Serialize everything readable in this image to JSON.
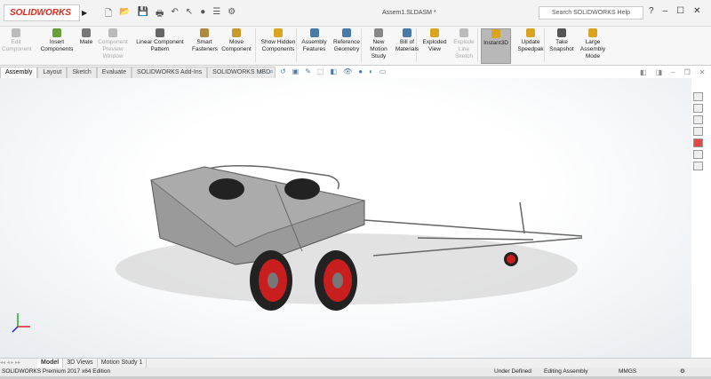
{
  "app": {
    "logo": "SOLIDWORKS",
    "document_title": "Assem1.SLDASM *",
    "search_placeholder": "Search SOLIDWORKS Help"
  },
  "window_controls": {
    "help": "?",
    "minimize": "–",
    "maximize": "☐",
    "close": "✕"
  },
  "ribbon": [
    {
      "label": "Edit Component",
      "disabled": true,
      "color": "#bbbbbb"
    },
    {
      "label": "Insert Components",
      "color": "#6a9e3b"
    },
    {
      "label": "Mate",
      "color": "#777777"
    },
    {
      "label": "Component Preview Window",
      "disabled": true,
      "color": "#bbbbbb"
    },
    {
      "label": "Linear Component Pattern",
      "color": "#666666"
    },
    {
      "label": "Smart Fasteners",
      "color": "#b08a3c"
    },
    {
      "label": "Move Component",
      "color": "#c99a2c"
    },
    {
      "label": "Show Hidden Components",
      "color": "#d9a520"
    },
    {
      "label": "Assembly Features",
      "color": "#4a7aa8"
    },
    {
      "label": "Reference Geometry",
      "color": "#4a7aa8"
    },
    {
      "label": "New Motion Study",
      "color": "#888888"
    },
    {
      "label": "Bill of Materials",
      "color": "#4a7aa8"
    },
    {
      "label": "Exploded View",
      "color": "#d9a520"
    },
    {
      "label": "Explode Line Sketch",
      "disabled": true,
      "color": "#bbbbbb"
    },
    {
      "label": "Instant3D",
      "active": true,
      "color": "#d9a520"
    },
    {
      "label": "Update Speedpak",
      "color": "#d9a520"
    },
    {
      "label": "Take Snapshot",
      "color": "#555555"
    },
    {
      "label": "Large Assembly Mode",
      "color": "#d9a520"
    }
  ],
  "tabs": [
    "Assembly",
    "Layout",
    "Sketch",
    "Evaluate",
    "SOLIDWORKS Add-Ins",
    "SOLIDWORKS MBD"
  ],
  "bottom_tabs": [
    "Model",
    "3D Views",
    "Motion Study 1"
  ],
  "status": {
    "edition": "SOLIDWORKS Premium 2017 x64 Edition",
    "state": "Under Defined",
    "mode": "Editing Assembly",
    "units": "MMGS"
  }
}
